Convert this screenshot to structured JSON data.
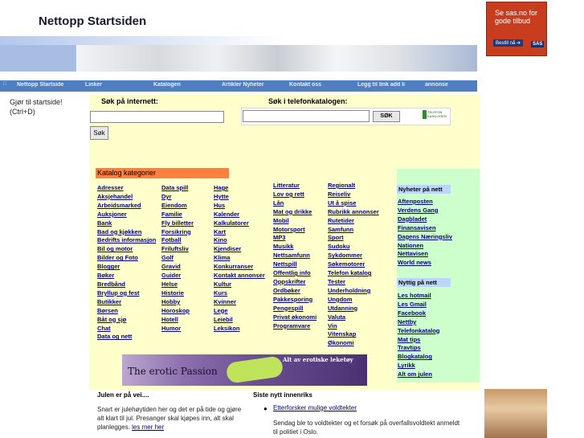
{
  "header": {
    "title": "Nettopp Startsiden"
  },
  "nav": {
    "items": [
      "Nettopp Startside",
      "Linker",
      "Katalogen",
      "Artikler Nyheter",
      "Kontakt oss",
      "Legg til link add li",
      "annonse"
    ]
  },
  "ad_top": {
    "line1": "Se sas.no for gode tilbud",
    "button": "Bestill nå ➔",
    "logo": "SAS"
  },
  "left": {
    "bookmark": "Gjør til startside! (Ctrl+D)"
  },
  "search": {
    "internet_label": "Søk på internett:",
    "internet_button": "Søk",
    "phone_label": "Søk i telefonkatalogen:",
    "phone_button": "SØK",
    "phone_logo": "TELEFON KATALOGEN"
  },
  "catalog": {
    "heading": "Katalog kategorier",
    "col1": [
      "Adresser",
      "Aksjehandel",
      "Arbeidsmarked",
      "Auksjoner",
      "Bank",
      "Bad og kjøkken",
      "Bedrifts informasjon",
      "Bil og motor",
      "Bilder og Foto",
      "Blogger",
      "Bøker",
      "Bredbånd",
      "Bryllup og fest",
      "Butikker",
      "Børsen",
      "Båt og sjø",
      "Chat",
      "Data og nett"
    ],
    "col2": [
      "Data spill",
      "Dyr",
      "Eiendom",
      "Familie",
      "Fly billetter",
      "Forsikring",
      "Fotball",
      "Friluftsliv",
      "Golf",
      "Gravid",
      "Guider",
      "Helse",
      "Historie",
      "Hobby",
      "Horoskop",
      "Hotell",
      "Humor"
    ],
    "col3": [
      "Hage",
      "Hytte",
      "Hus",
      "Kalender",
      "Kalkulatorer",
      "Kart",
      "Kino",
      "Kjendiser",
      "Klima",
      "Konkurranser",
      "Kontakt annonser",
      "Kultur",
      "Kurs",
      "Kvinner",
      "Lege",
      "Leiebil",
      "Leksikon"
    ],
    "col4": [
      "Litteratur",
      "Lov og rett",
      "Lån",
      "Mat og drikke",
      "Mobil",
      "Motorsport",
      "MP3",
      "Musikk",
      "Nettsamfunn",
      "Nettspill",
      "Offentlig info",
      "Oppskrifter",
      "Ordbøker",
      "Pakkesporing",
      "Pengespill",
      "Privat økonomi",
      "Programvare"
    ],
    "col5": [
      "Regionalt",
      "Reiseliv",
      "Ut å spise",
      "Rubrikk annonser",
      "Rutetider",
      "Samfunn",
      "Sport",
      "Sudoku",
      "Sykdommer",
      "Søkemotorer",
      "Telefon katalog",
      "Tester",
      "Underholdning",
      "Ungdom",
      "Utdanning",
      "Valuta",
      "Vin",
      "Vitenskap",
      "Økonomi"
    ]
  },
  "news_panel": {
    "heading1": "Nyheter på nett",
    "news": [
      "Aftenposten",
      "Verdens Gang",
      "Dagbladet",
      "Finansavisen",
      "Dagens Næringsliv",
      "Nationen",
      "Nettavisen",
      "World news"
    ],
    "heading2": "Nyttig på nett",
    "useful": [
      "Les hotmail",
      "Les Gmail",
      "Facebook",
      "Nettby",
      "Telefonkatalog",
      "Mat tips",
      "Travtips",
      "Blogkatalog",
      "Lyrikk",
      "Alt om julen"
    ]
  },
  "erotic_banner": {
    "left_text": "The erotic Passion",
    "right_text": "Alt av erotiske leketøy"
  },
  "bottom": {
    "julen_heading": "Julen er på vei....",
    "julen_text": "Snart er juleh​øytiden her og det er på tide og gjøre alt klart til jul. Presanger skal kjøpes inn, alt skal planlegges.",
    "julen_link": "les mer her",
    "innenriks_heading": "Siste nytt innenriks",
    "innenriks_link": "Etterforsker mulige voldtekter",
    "innenriks_text": "Sendag ble to voldtekter og et forsøk på overfallsvoldtekt anmeldt til politiet i Oslo."
  }
}
